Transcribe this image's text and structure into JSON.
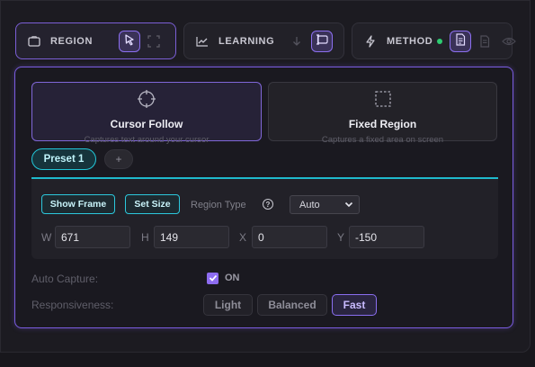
{
  "tabs": [
    {
      "label": "REGION",
      "icon": "square-icon"
    },
    {
      "label": "LEARNING",
      "icon": "chart-line-icon"
    },
    {
      "label": "METHOD",
      "icon": "bolt-icon"
    }
  ],
  "modes": [
    {
      "title": "Cursor Follow",
      "subtitle": "Captures text around your cursor"
    },
    {
      "title": "Fixed Region",
      "subtitle": "Captures a fixed area on screen"
    }
  ],
  "presets": {
    "active": "Preset 1",
    "add_label": "+"
  },
  "region": {
    "show_frame": "Show Frame",
    "set_size": "Set Size",
    "region_type_label": "Region Type",
    "help_glyph": "?",
    "region_type_value": "Auto",
    "fields": [
      {
        "label": "W",
        "value": "671"
      },
      {
        "label": "H",
        "value": "149"
      },
      {
        "label": "X",
        "value": "0"
      },
      {
        "label": "Y",
        "value": "-150"
      }
    ]
  },
  "auto_capture": {
    "label": "Auto Capture:",
    "state": "ON",
    "checked": true
  },
  "responsiveness": {
    "label": "Responsiveness:",
    "options": [
      "Light",
      "Balanced",
      "Fast"
    ],
    "selected": "Fast"
  },
  "colors": {
    "accent": "#8a6ef0",
    "cyan": "#22c7d8",
    "status_dot": "#2ecc71"
  }
}
